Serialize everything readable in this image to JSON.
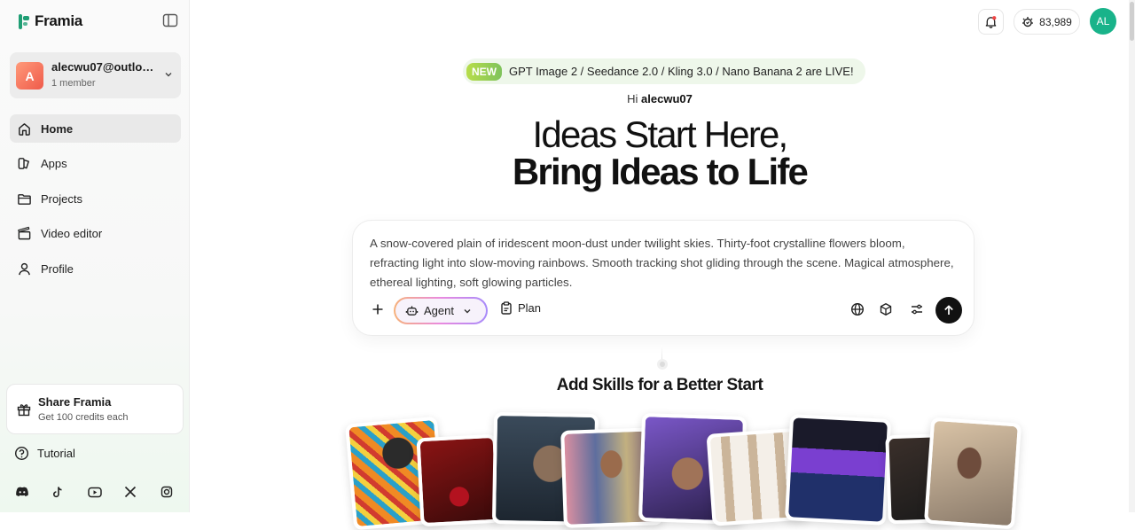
{
  "app": {
    "name": "Framia"
  },
  "workspace": {
    "name": "alecwu07@outloo...",
    "members": "1 member",
    "avatar_letter": "A"
  },
  "nav": [
    {
      "label": "Home",
      "icon": "home-icon",
      "active": true
    },
    {
      "label": "Apps",
      "icon": "apps-icon"
    },
    {
      "label": "Projects",
      "icon": "folder-icon"
    },
    {
      "label": "Video editor",
      "icon": "clapperboard-icon"
    },
    {
      "label": "Profile",
      "icon": "user-icon"
    }
  ],
  "share": {
    "title": "Share Framia",
    "subtitle": "Get 100 credits each"
  },
  "tutorial": {
    "label": "Tutorial"
  },
  "socials": [
    "discord-icon",
    "tiktok-icon",
    "youtube-icon",
    "x-icon",
    "instagram-icon"
  ],
  "topbar": {
    "credits": "83,989",
    "avatar_initials": "AL"
  },
  "banner": {
    "badge": "NEW",
    "text": "GPT Image 2 / Seedance 2.0 / Kling 3.0 / Nano Banana 2 are LIVE!"
  },
  "greeting": {
    "prefix": "Hi",
    "username": "alecwu07"
  },
  "hero": {
    "line1": "Ideas Start Here,",
    "line2": "Bring Ideas to Life"
  },
  "prompt": {
    "text": "A snow-covered plain of iridescent moon-dust under twilight skies. Thirty-foot crystalline flowers bloom, refracting light into slow-moving rainbows. Smooth tracking shot gliding through the scene. Magical atmosphere, ethereal lighting, soft glowing particles.",
    "agent_label": "Agent",
    "plan_label": "Plan"
  },
  "skills": {
    "title": "Add Skills for a Better Start"
  },
  "colors": {
    "brand": "#1f9e74",
    "avatar": "#19b38a",
    "banner_bg": "#eef7ea"
  }
}
